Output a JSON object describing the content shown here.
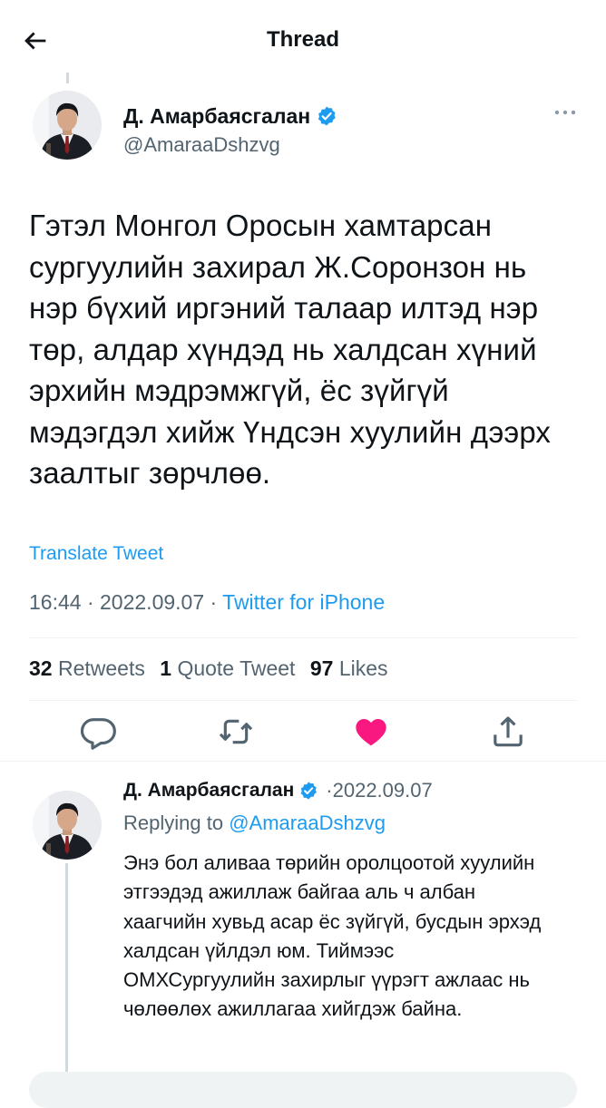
{
  "header": {
    "title": "Thread",
    "back_icon": "arrow-left-icon"
  },
  "main_tweet": {
    "display_name": "Д. Амарбаясгалан",
    "handle": "@AmaraaDshzvg",
    "verified": true,
    "text": "Гэтэл Монгол Оросын хамтарсан сургуулийн захирал Ж.Соронзон нь нэр бүхий иргэний талаар илтэд нэр төр, алдар хүндэд нь халдсан хүний эрхийн мэдрэмжгүй, ёс зүйгүй мэдэгдэл хийж Үндсэн хуулийн дээрх заалтыг зөрчлөө.",
    "translate_label": "Translate Tweet",
    "time": "16:44",
    "separator": " · ",
    "date": "2022.09.07",
    "source": "Twitter for iPhone",
    "stats": {
      "retweets_count": "32",
      "retweets_label": "Retweets",
      "quotes_count": "1",
      "quotes_label": "Quote Tweet",
      "likes_count": "97",
      "likes_label": "Likes"
    },
    "actions": {
      "reply_icon": "reply-icon",
      "retweet_icon": "retweet-icon",
      "like_icon": "heart-filled-icon",
      "share_icon": "share-icon",
      "liked": true
    }
  },
  "reply_tweet": {
    "display_name": "Д. Амарбаясгалан",
    "verified": true,
    "date_prefix": "·",
    "date": "2022.09.07",
    "replying_label": "Replying to",
    "replying_to": "@AmaraaDshzvg",
    "text": "Энэ бол аливаа төрийн оролцоотой хуулийн этгээдэд ажиллаж байгаа аль ч албан хаагчийн хувьд асар ёс зүйгүй, бусдын эрхэд халдсан үйлдэл юм. Тиймээс ОМХСургуулийн захирлыг үүрэгт ажлаас нь чөлөөлөх ажиллагаа хийгдэж байна."
  },
  "colors": {
    "accent": "#1d9bf0",
    "like": "#f91880",
    "text": "#0f1419",
    "secondary": "#536471"
  }
}
